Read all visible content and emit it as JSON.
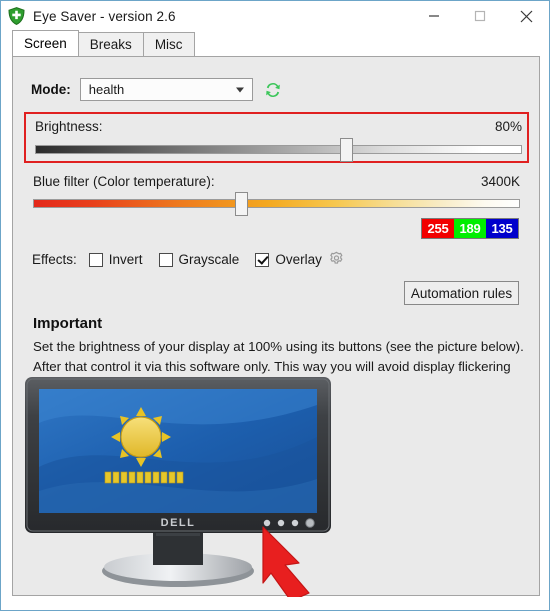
{
  "window": {
    "title": "Eye Saver - version 2.6",
    "app_icon": "shield-icon",
    "controls": {
      "minimize": "minimize-icon",
      "maximize": "maximize-icon",
      "close": "close-icon"
    }
  },
  "tabs": [
    {
      "label": "Screen",
      "active": true
    },
    {
      "label": "Breaks",
      "active": false
    },
    {
      "label": "Misc",
      "active": false
    }
  ],
  "screen_tab": {
    "mode": {
      "label": "Mode:",
      "value": "health",
      "refresh_icon": "refresh-icon"
    },
    "brightness": {
      "label": "Brightness:",
      "value": "80%",
      "percent": 80,
      "thumb_position_percent": 62,
      "highlight_color": "#e02020"
    },
    "blue_filter": {
      "label": "Blue filter (Color temperature):",
      "value": "3400K",
      "kelvin": 3400,
      "thumb_position_percent": 41
    },
    "rgb_preview": [
      {
        "channel": "R",
        "value": "255",
        "color": "#f20000"
      },
      {
        "channel": "G",
        "value": "189",
        "color": "#00ee00"
      },
      {
        "channel": "B",
        "value": "135",
        "color": "#0000cc"
      }
    ],
    "effects": {
      "label": "Effects:",
      "items": [
        {
          "label": "Invert",
          "checked": false
        },
        {
          "label": "Grayscale",
          "checked": false
        },
        {
          "label": "Overlay",
          "checked": true
        }
      ],
      "settings_icon": "gear-icon"
    },
    "automation_button": "Automation rules",
    "important": {
      "heading": "Important",
      "body": "Set the brightness of your display at 100% using its buttons (see the picture below). After that control it via this software only. This way you will avoid display flickering which is causing eye strain and headache."
    },
    "illustration": {
      "brand_label": "DELL",
      "osd_icon": "sun-brightness-icon",
      "osd_segments": 15,
      "pointer_icon": "red-arrow-icon",
      "monitor_button_count": 4
    }
  }
}
